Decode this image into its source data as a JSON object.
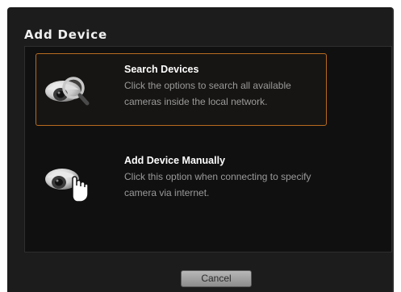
{
  "dialog": {
    "title": "Add Device",
    "options": [
      {
        "title": "Search Devices",
        "description": "Click the options to search all available cameras inside the local network.",
        "icon": "camera-search-icon",
        "selected": true
      },
      {
        "title": "Add Device Manually",
        "description": "Click this option when connecting to specify camera via internet.",
        "icon": "camera-hand-icon",
        "selected": false
      }
    ],
    "cancel_label": "Cancel"
  },
  "colors": {
    "selected_border": "#b86b1f",
    "background": "#1c1c1c"
  }
}
